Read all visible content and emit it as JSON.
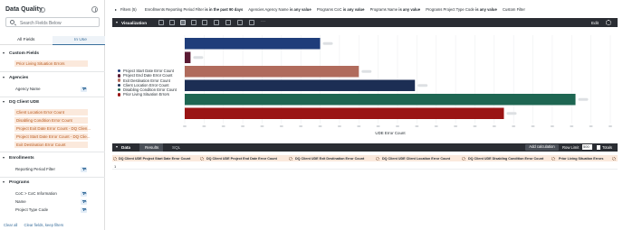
{
  "sidebar": {
    "title": "Data Quality",
    "search_placeholder": "Search Fields Below",
    "tabs": [
      "All Fields",
      "In Use"
    ],
    "sections": [
      {
        "name": "Custom Fields",
        "items": [
          {
            "label": "Prior Living Situation Errors",
            "highlight": true
          }
        ]
      },
      {
        "name": "Agencies",
        "items": [
          {
            "label": "Agency Name",
            "filter": true
          }
        ]
      },
      {
        "name": "DQ Client UDE",
        "items": [
          {
            "label": "Client Location Error Count",
            "highlight": true
          },
          {
            "label": "Disabling Condition Error Count",
            "highlight": true
          },
          {
            "label": "Project Exit Date Error Count - DQ Clien...",
            "highlight": true
          },
          {
            "label": "Project Start Date Error Count - DQ Clie...",
            "highlight": true
          },
          {
            "label": "Exit Destination Error Count",
            "highlight": true
          }
        ]
      },
      {
        "name": "Enrollments",
        "items": [
          {
            "label": "Reporting Period Filter",
            "filter": true
          }
        ]
      },
      {
        "name": "Programs",
        "items": [
          {
            "label": "CoC > CoC Information",
            "filter": true
          },
          {
            "label": "Name",
            "filter": true
          },
          {
            "label": "Project Type Code",
            "filter": true
          }
        ]
      }
    ],
    "footer": {
      "clear_all": "Clear all",
      "clear_keep": "Clear fields, keep filters"
    }
  },
  "filters": {
    "label": "Filters (5)",
    "items": [
      {
        "name": "Enrollments Reporting Period Filter",
        "cond": "is in the past 90 days"
      },
      {
        "name": "Agencies Agency Name",
        "cond": "is any value"
      },
      {
        "name": "Programs CoC",
        "cond": "is any value"
      },
      {
        "name": "Programs Name",
        "cond": "is any value"
      },
      {
        "name": "Programs Project Type Code",
        "cond": "is any value"
      }
    ],
    "custom": "Custom Filter"
  },
  "visualization": {
    "title": "Visualization",
    "tools": [
      "table-icon",
      "column-chart-icon",
      "bar-chart-icon",
      "scatter-icon",
      "line-icon",
      "area-icon",
      "pie-icon",
      "map-icon",
      "single-value-icon",
      "more-icon"
    ],
    "active_tool_index": 2,
    "edit_label": "Edit"
  },
  "chart_data": {
    "type": "bar",
    "orientation": "horizontal",
    "xlabel": "UDE Error Count",
    "grid": true,
    "legend_position": "left",
    "xlim": [
      0,
      22
    ],
    "series": [
      {
        "name": "Project Start Date Error Count",
        "color": "#1f3d7a",
        "value": 7.0
      },
      {
        "name": "Project End Date Error Count",
        "color": "#5a1a33",
        "value": 0.3
      },
      {
        "name": "Exit Destination Error Count",
        "color": "#b06b5c",
        "value": 9.0
      },
      {
        "name": "Client Location Error Count",
        "color": "#1c2e54",
        "value": 11.9
      },
      {
        "name": "Disabling Condition Error Count",
        "color": "#1e6652",
        "value": 20.2
      },
      {
        "name": "Prior Living Situation Errors",
        "color": "#9a1414",
        "value": 16.5
      }
    ]
  },
  "data_panel": {
    "title": "Data",
    "tabs": [
      "Results",
      "SQL"
    ],
    "add_calc": "Add calculation",
    "row_limit_label": "Row Limit",
    "row_limit": "500",
    "totals_label": "Totals",
    "columns": [
      "DQ Client UDE Project Start Date Error Count",
      "DQ Client UDE Project End Date Error Count",
      "DQ Client UDE Exit Destination Error Count",
      "DQ Client UDE Client Location Error Count",
      "DQ Client UDE Disabling Condition Error Count",
      "Prior Living Situation Errors"
    ],
    "row_number": "1"
  }
}
